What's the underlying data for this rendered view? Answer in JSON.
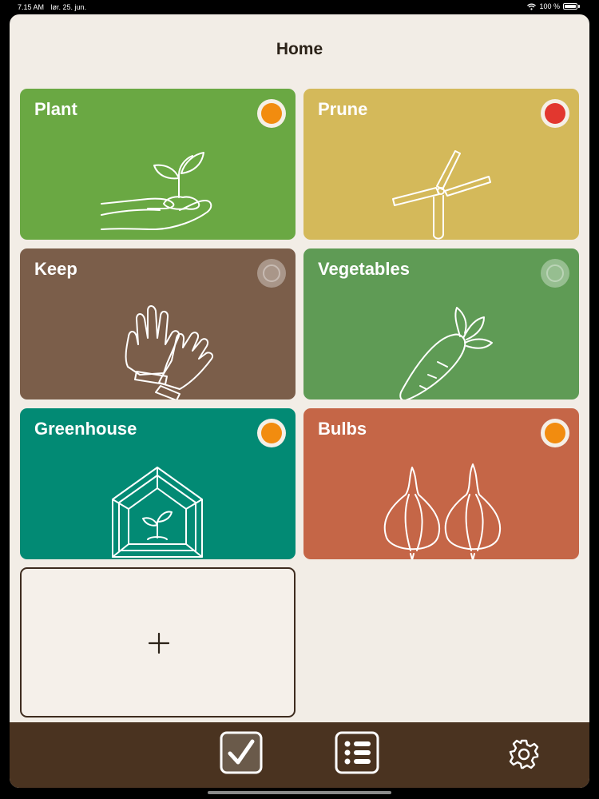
{
  "status": {
    "time": "7.15 AM",
    "date": "lør. 25. jun.",
    "battery": "100 %"
  },
  "page": {
    "title": "Home"
  },
  "tiles": [
    {
      "label": "Plant",
      "bg": "#6aa843",
      "dot": "#f28c0f",
      "icon": "hand-sprout-icon"
    },
    {
      "label": "Prune",
      "bg": "#d4b95a",
      "dot": "#e2372f",
      "icon": "pruning-shears-icon"
    },
    {
      "label": "Keep",
      "bg": "#7b5e4a",
      "dot": "",
      "icon": "gardening-gloves-icon"
    },
    {
      "label": "Vegetables",
      "bg": "#5f9b55",
      "dot": "",
      "icon": "carrot-icon"
    },
    {
      "label": "Greenhouse",
      "bg": "#028a74",
      "dot": "#f28c0f",
      "icon": "greenhouse-icon"
    },
    {
      "label": "Bulbs",
      "bg": "#c56647",
      "dot": "#f28c0f",
      "icon": "bulbs-icon"
    }
  ],
  "add_tile": {
    "icon": "plus-icon"
  },
  "tabbar": {
    "bg": "#4a3320",
    "items": [
      {
        "icon": "checkbox-icon"
      },
      {
        "icon": "list-icon"
      },
      {
        "icon": "gear-icon"
      }
    ]
  }
}
